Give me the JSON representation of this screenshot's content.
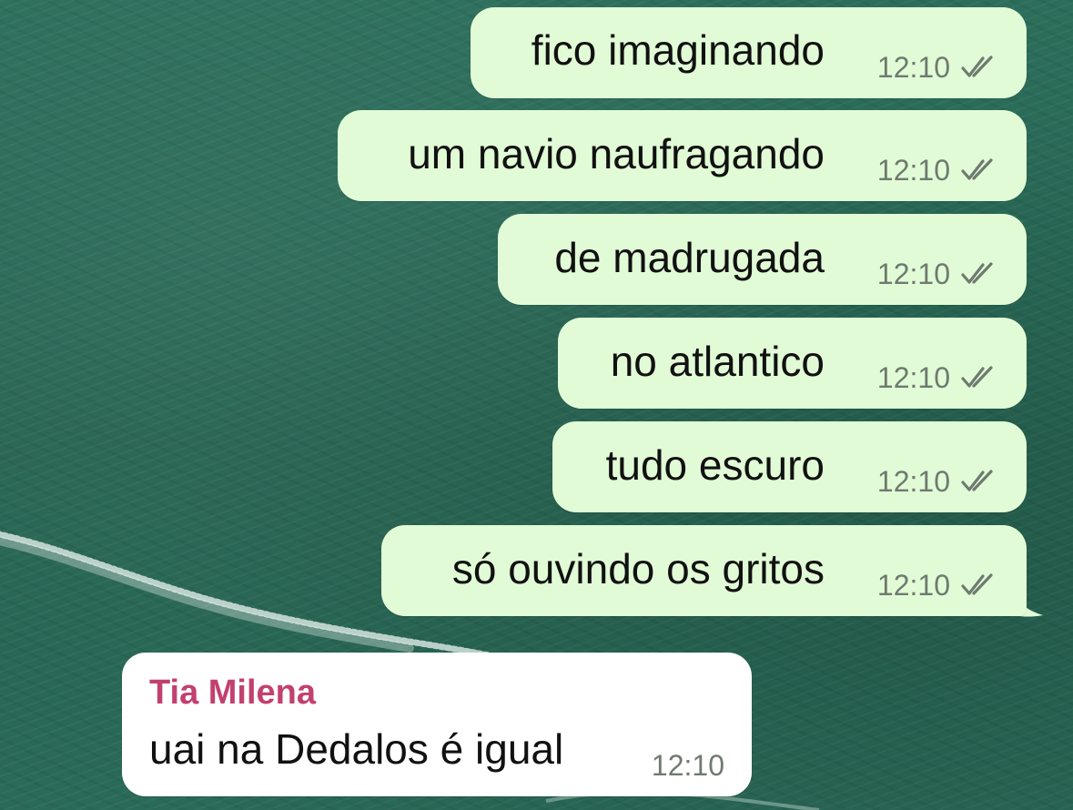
{
  "chat": {
    "outgoing_messages": [
      {
        "text": "fico imaginando",
        "time": "12:10",
        "status_icon": "double-check-icon"
      },
      {
        "text": "um navio naufragando",
        "time": "12:10",
        "status_icon": "double-check-icon"
      },
      {
        "text": "de madrugada",
        "time": "12:10",
        "status_icon": "double-check-icon"
      },
      {
        "text": "no atlantico",
        "time": "12:10",
        "status_icon": "double-check-icon"
      },
      {
        "text": "tudo escuro",
        "time": "12:10",
        "status_icon": "double-check-icon"
      },
      {
        "text": "só ouvindo os gritos",
        "time": "12:10",
        "status_icon": "double-check-icon"
      }
    ],
    "incoming_message": {
      "sender": "Tia Milena",
      "text": "uai na Dedalos é igual",
      "time": "12:10"
    }
  },
  "colors": {
    "outgoing_bubble": "#e1fbd6",
    "incoming_bubble": "#ffffff",
    "sender_name": "#c2406f",
    "background": "#2a6a57",
    "ticks": "#6f7a70"
  }
}
